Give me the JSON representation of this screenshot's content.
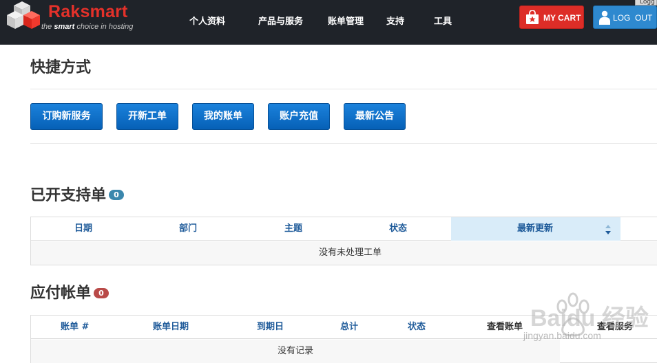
{
  "brand": {
    "name": "Raksmart",
    "tagline_prefix": "the ",
    "tagline_bold": "smart",
    "tagline_suffix": " choice in hosting",
    "accent": "#e4312a"
  },
  "nav": {
    "items": [
      {
        "label": "个人资料"
      },
      {
        "label": "产品与服务"
      },
      {
        "label": "账单管理"
      },
      {
        "label": "支持"
      },
      {
        "label": "工具"
      }
    ]
  },
  "header_actions": {
    "cart_label": "MY CART",
    "cart_icon": "shopping-bag-icon",
    "logout_label": "LOG  OUT",
    "logout_icon": "user-icon",
    "logged_tab": "Logg"
  },
  "shortcuts": {
    "title": "快捷方式",
    "buttons": [
      {
        "label": "订购新服务"
      },
      {
        "label": "开新工单"
      },
      {
        "label": "我的账单"
      },
      {
        "label": "账户充值"
      },
      {
        "label": "最新公告"
      }
    ]
  },
  "tickets": {
    "title": "已开支持单",
    "count": "0",
    "badge_color": "#3a87ad",
    "columns": [
      "日期",
      "部门",
      "主题",
      "状态",
      "最新更新"
    ],
    "sorted_column": "最新更新",
    "empty_message": "没有未处理工单"
  },
  "invoices": {
    "title": "应付帐单",
    "count": "0",
    "badge_color": "#b94a48",
    "columns": [
      "账单 #",
      "账单日期",
      "到期日",
      "总计",
      "状态",
      "查看账单",
      "查看服务"
    ],
    "empty_message": "没有记录"
  },
  "watermark": {
    "text": "Baidu 经验",
    "url": "jingyan.baidu.com"
  }
}
